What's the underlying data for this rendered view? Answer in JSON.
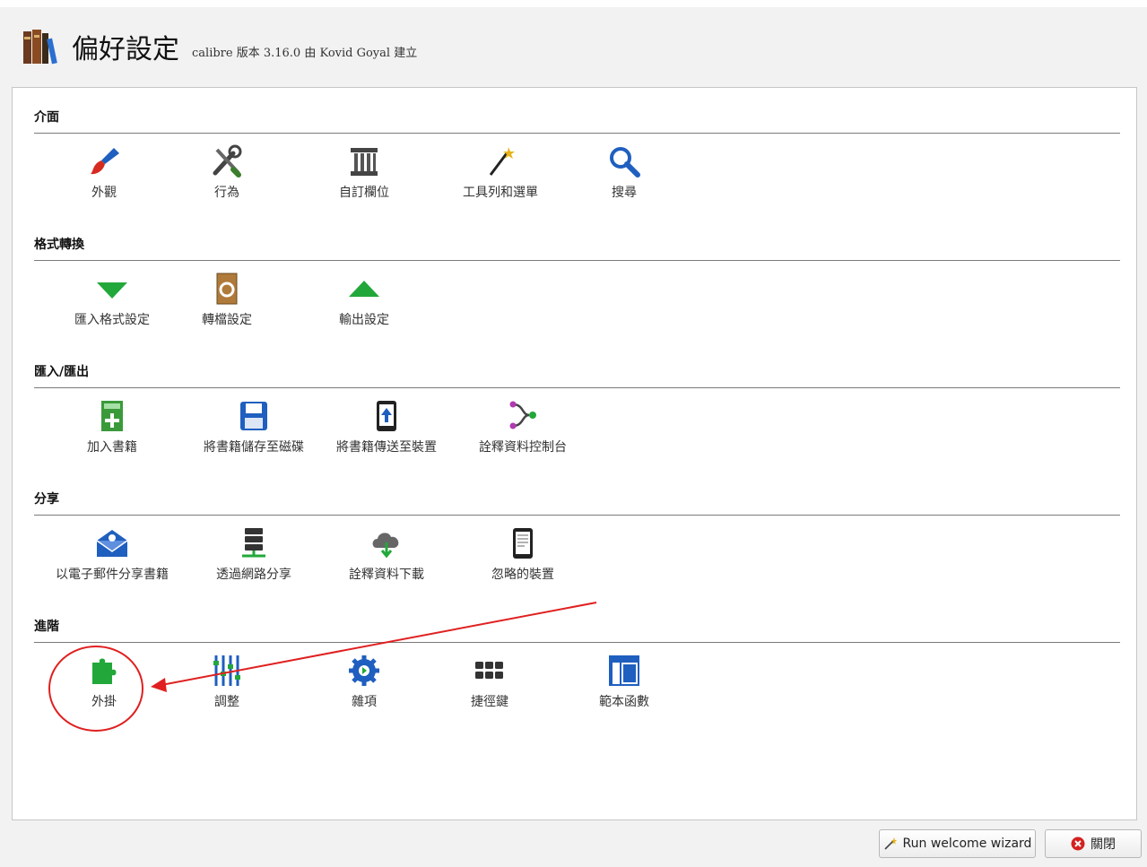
{
  "window": {
    "title": "偏好設定",
    "subtitle": "calibre 版本 3.16.0 由 Kovid Goyal 建立"
  },
  "sections": [
    {
      "title": "介面",
      "items": [
        {
          "label": "外觀",
          "icon": "paintbrush-icon"
        },
        {
          "label": "行為",
          "icon": "tools-icon"
        },
        {
          "label": "自訂欄位",
          "icon": "column-icon"
        },
        {
          "label": "工具列和選單",
          "icon": "magic-wand-icon"
        },
        {
          "label": "搜尋",
          "icon": "search-icon"
        }
      ]
    },
    {
      "title": "格式轉換",
      "items": [
        {
          "label": "匯入格式設定",
          "icon": "arrow-down-icon"
        },
        {
          "label": "轉檔設定",
          "icon": "convert-book-icon"
        },
        {
          "label": "輸出設定",
          "icon": "arrow-up-icon"
        }
      ]
    },
    {
      "title": "匯入/匯出",
      "items": [
        {
          "label": "加入書籍",
          "icon": "add-book-icon"
        },
        {
          "label": "將書籍儲存至磁碟",
          "icon": "save-disk-icon"
        },
        {
          "label": "將書籍傳送至裝置",
          "icon": "send-device-icon"
        },
        {
          "label": "詮釋資料控制台",
          "icon": "metadata-merge-icon"
        }
      ]
    },
    {
      "title": "分享",
      "items": [
        {
          "label": "以電子郵件分享書籍",
          "icon": "mail-icon"
        },
        {
          "label": "透過網路分享",
          "icon": "server-icon"
        },
        {
          "label": "詮釋資料下載",
          "icon": "cloud-download-icon"
        },
        {
          "label": "忽略的裝置",
          "icon": "device-icon"
        }
      ]
    },
    {
      "title": "進階",
      "items": [
        {
          "label": "外掛",
          "icon": "plugin-icon"
        },
        {
          "label": "調整",
          "icon": "tweaks-icon"
        },
        {
          "label": "雜項",
          "icon": "gear-icon"
        },
        {
          "label": "捷徑鍵",
          "icon": "keyboard-icon"
        },
        {
          "label": "範本函數",
          "icon": "template-icon"
        }
      ]
    }
  ],
  "footer": {
    "wizard_label": "Run welcome wizard",
    "close_label": "關閉"
  },
  "colors": {
    "annotation": "#e02020",
    "accent_blue": "#1f5fbf",
    "green": "#22a83a"
  }
}
